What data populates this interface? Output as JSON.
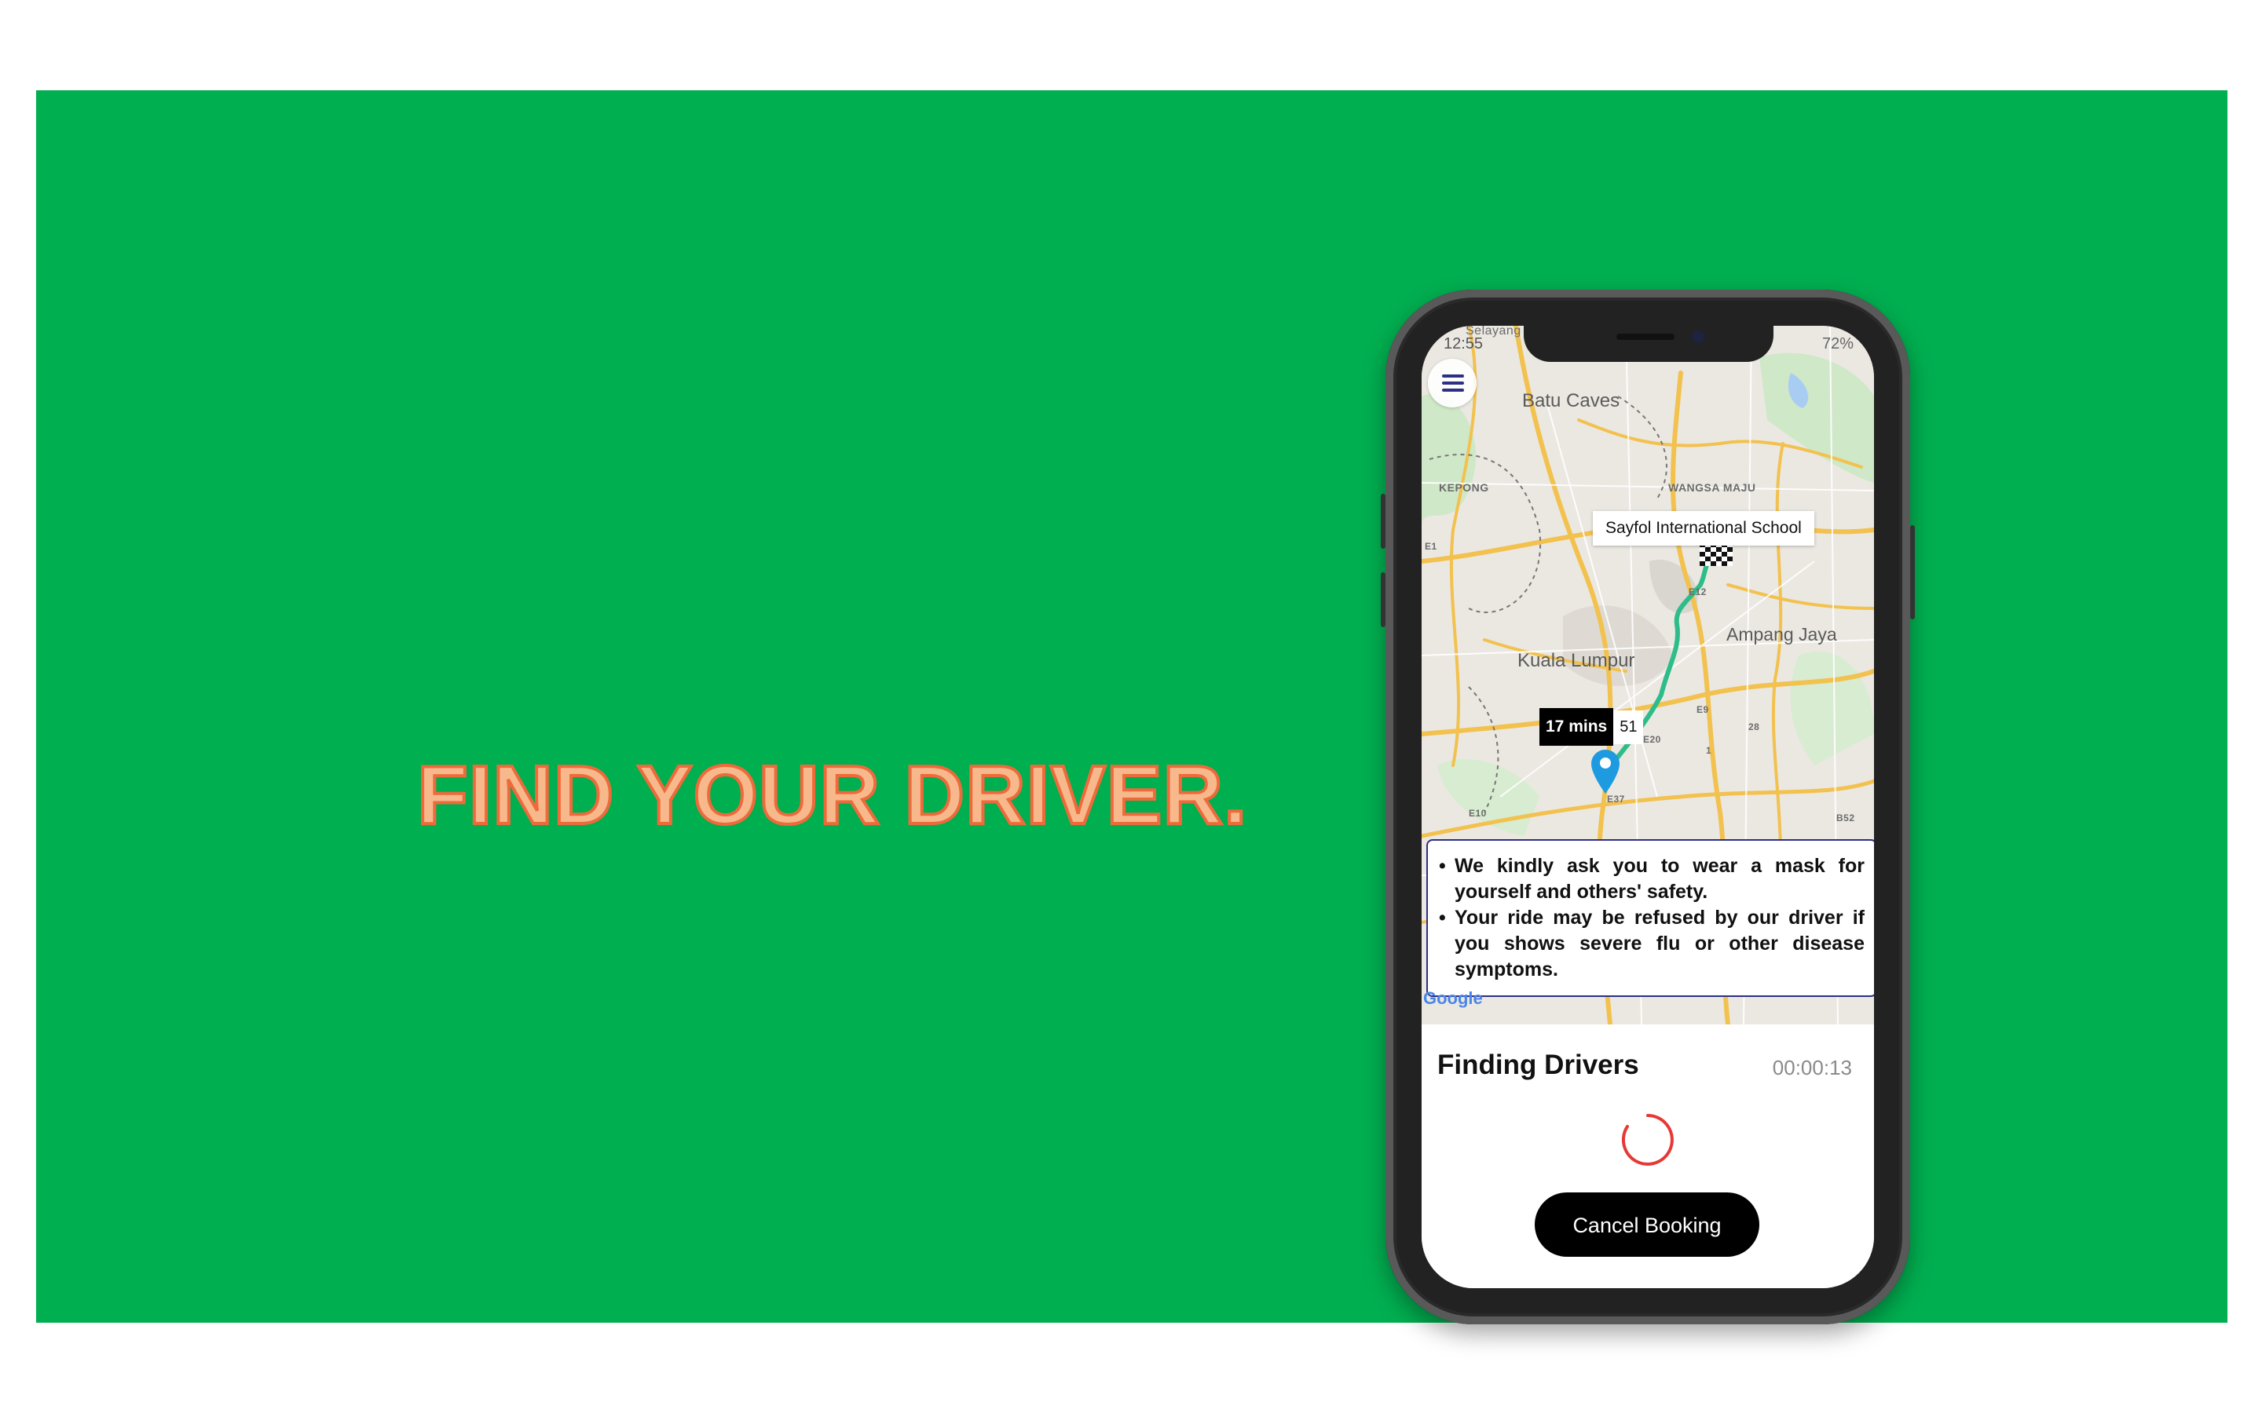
{
  "headline": "FIND YOUR DRIVER.",
  "status_bar": {
    "time": "12:55",
    "right": "72%"
  },
  "map": {
    "labels": {
      "selayang": "Selayang",
      "batu_caves": "Batu Caves",
      "kepong": "KEPONG",
      "wangsa_maju": "WANGSA MAJU",
      "kuala_lumpur": "Kuala Lumpur",
      "ampang_jaya": "Ampang Jaya",
      "e1": "E1",
      "e12": "E12",
      "e9": "E9",
      "e20": "E20",
      "e37": "E37",
      "e10": "E10",
      "r28": "28",
      "r1": "1",
      "b52": "B52"
    },
    "destination": "Sayfol International School",
    "eta_label": "17 mins",
    "eta_extra": "51",
    "google": "Google"
  },
  "notice": {
    "items": [
      "We kindly ask you to wear a mask for yourself and others' safety.",
      "Your ride may be refused by our driver if you shows severe flu or other disease symptoms."
    ]
  },
  "panel": {
    "title": "Finding Drivers",
    "timer": "00:00:13",
    "cancel_label": "Cancel Booking"
  },
  "colors": {
    "banner": "#00af50",
    "headline_fill": "#f7b88c",
    "headline_stroke": "#ee6a3b",
    "route": "#2ebd8a",
    "pin": "#1e9be0",
    "spinner": "#e53935",
    "menu_icon": "#2b2f86"
  },
  "icons": [
    "menu-icon",
    "checkered-flag-icon",
    "location-pin-icon",
    "loading-spinner-icon",
    "camera-icon"
  ]
}
